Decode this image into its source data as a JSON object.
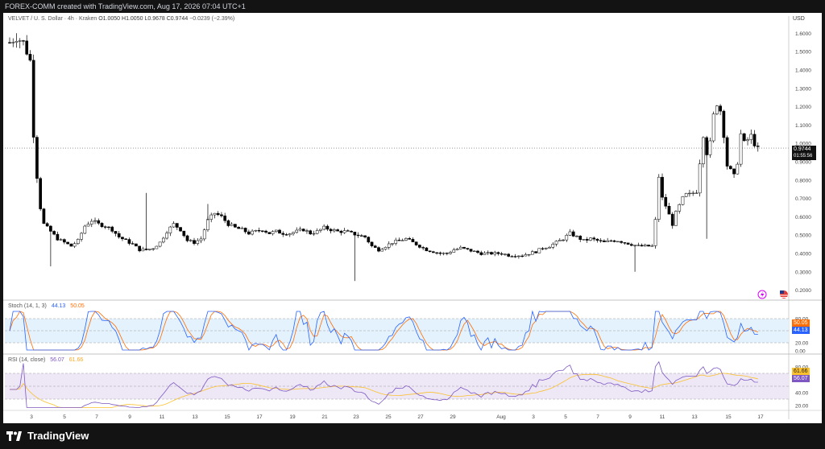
{
  "header": {
    "watermark": "FOREX-COMM created with TradingView.com, Aug 17, 2026 07:04 UTC+1"
  },
  "symbol": {
    "title": "VELVET / U. S. Dollar · 4h · Kraken",
    "ohlc": [
      {
        "label": "O",
        "value": "1.0050"
      },
      {
        "label": "H",
        "value": "1.0050"
      },
      {
        "label": "L",
        "value": "0.9678"
      },
      {
        "label": "C",
        "value": "0.9744"
      }
    ],
    "change": "−0.0239 (−2.39%)",
    "currency": "USD",
    "last_price": "0.9744",
    "countdown": "01:55:56"
  },
  "stoch": {
    "label": "Stoch (14, 1, 3)",
    "k": "44.13",
    "d": "50.05",
    "ticks": [
      "80.00",
      "20.00",
      "0.00"
    ],
    "k_color": "#2962ff",
    "d_color": "#ff6d00"
  },
  "rsi": {
    "label": "RSI (14, close)",
    "rsi": "56.07",
    "ma": "61.66",
    "ticks": [
      "80.00",
      "60.00",
      "40.00",
      "20.00"
    ],
    "rsi_color": "#7e57c2",
    "ma_color": "#fbc02d"
  },
  "xaxis": {
    "labels": [
      "3",
      "5",
      "7",
      "9",
      "11",
      "13",
      "15",
      "17",
      "19",
      "21",
      "23",
      "25",
      "27",
      "29",
      "Aug",
      "3",
      "5",
      "7",
      "9",
      "11",
      "13",
      "15",
      "17"
    ]
  },
  "brand": {
    "name": "TradingView"
  },
  "icons": [
    "lightning-icon",
    "us-flag-icon"
  ],
  "chart_data": {
    "type": "candlestick",
    "title": "VELVET / U. S. Dollar · 4h · Kraken",
    "ylabel": "USD",
    "y_ticks": [
      "1.6000",
      "1.5000",
      "1.4000",
      "1.3000",
      "1.2000",
      "1.1000",
      "1.0000",
      "0.9000",
      "0.8000",
      "0.7000",
      "0.6000",
      "0.5000",
      "0.4000",
      "0.3000",
      "0.2000"
    ],
    "ylim": [
      0.15,
      1.65
    ],
    "up_color": "#ffffff",
    "down_color": "#000000",
    "price_line": 0.9744,
    "x_labels": [
      "3",
      "5",
      "7",
      "9",
      "11",
      "13",
      "15",
      "17",
      "19",
      "21",
      "23",
      "25",
      "27",
      "29",
      "Aug",
      "3",
      "5",
      "7",
      "9",
      "11",
      "13",
      "15",
      "17"
    ],
    "close_path": [
      [
        0,
        1.55
      ],
      [
        2,
        1.58
      ],
      [
        4,
        1.55
      ],
      [
        6,
        1.45
      ],
      [
        7,
        1.05
      ],
      [
        8,
        0.82
      ],
      [
        9,
        0.65
      ],
      [
        10,
        0.56
      ],
      [
        12,
        0.52
      ],
      [
        14,
        0.48
      ],
      [
        16,
        0.46
      ],
      [
        18,
        0.44
      ],
      [
        20,
        0.47
      ],
      [
        22,
        0.55
      ],
      [
        24,
        0.58
      ],
      [
        26,
        0.56
      ],
      [
        28,
        0.55
      ],
      [
        30,
        0.53
      ],
      [
        32,
        0.49
      ],
      [
        34,
        0.47
      ],
      [
        36,
        0.45
      ],
      [
        38,
        0.42
      ],
      [
        40,
        0.42
      ],
      [
        42,
        0.43
      ],
      [
        44,
        0.46
      ],
      [
        46,
        0.52
      ],
      [
        48,
        0.56
      ],
      [
        50,
        0.53
      ],
      [
        52,
        0.47
      ],
      [
        54,
        0.46
      ],
      [
        56,
        0.48
      ],
      [
        58,
        0.58
      ],
      [
        60,
        0.62
      ],
      [
        62,
        0.6
      ],
      [
        64,
        0.56
      ],
      [
        66,
        0.54
      ],
      [
        68,
        0.53
      ],
      [
        70,
        0.51
      ],
      [
        72,
        0.52
      ],
      [
        74,
        0.53
      ],
      [
        76,
        0.51
      ],
      [
        78,
        0.52
      ],
      [
        80,
        0.51
      ],
      [
        82,
        0.51
      ],
      [
        84,
        0.52
      ],
      [
        86,
        0.53
      ],
      [
        88,
        0.51
      ],
      [
        90,
        0.52
      ],
      [
        92,
        0.54
      ],
      [
        94,
        0.53
      ],
      [
        96,
        0.52
      ],
      [
        98,
        0.52
      ],
      [
        100,
        0.51
      ],
      [
        102,
        0.5
      ],
      [
        104,
        0.49
      ],
      [
        106,
        0.44
      ],
      [
        108,
        0.42
      ],
      [
        110,
        0.44
      ],
      [
        112,
        0.46
      ],
      [
        114,
        0.47
      ],
      [
        116,
        0.48
      ],
      [
        118,
        0.46
      ],
      [
        120,
        0.44
      ],
      [
        122,
        0.42
      ],
      [
        124,
        0.41
      ],
      [
        126,
        0.4
      ],
      [
        128,
        0.4
      ],
      [
        130,
        0.42
      ],
      [
        132,
        0.43
      ],
      [
        134,
        0.42
      ],
      [
        136,
        0.41
      ],
      [
        138,
        0.4
      ],
      [
        140,
        0.4
      ],
      [
        142,
        0.4
      ],
      [
        144,
        0.4
      ],
      [
        146,
        0.39
      ],
      [
        148,
        0.39
      ],
      [
        150,
        0.39
      ],
      [
        152,
        0.4
      ],
      [
        154,
        0.41
      ],
      [
        156,
        0.43
      ],
      [
        158,
        0.44
      ],
      [
        160,
        0.46
      ],
      [
        162,
        0.48
      ],
      [
        164,
        0.51
      ],
      [
        166,
        0.49
      ],
      [
        168,
        0.47
      ],
      [
        170,
        0.48
      ],
      [
        172,
        0.47
      ],
      [
        174,
        0.46
      ],
      [
        176,
        0.47
      ],
      [
        178,
        0.47
      ],
      [
        180,
        0.46
      ],
      [
        182,
        0.45
      ],
      [
        184,
        0.44
      ],
      [
        186,
        0.44
      ],
      [
        188,
        0.44
      ],
      [
        189,
        0.58
      ],
      [
        190,
        0.82
      ],
      [
        191,
        0.7
      ],
      [
        192,
        0.66
      ],
      [
        193,
        0.61
      ],
      [
        194,
        0.56
      ],
      [
        195,
        0.62
      ],
      [
        196,
        0.66
      ],
      [
        197,
        0.7
      ],
      [
        198,
        0.72
      ],
      [
        199,
        0.72
      ],
      [
        200,
        0.73
      ],
      [
        201,
        0.74
      ],
      [
        202,
        0.9
      ],
      [
        203,
        1.05
      ],
      [
        204,
        0.95
      ],
      [
        205,
        1.0
      ],
      [
        206,
        1.15
      ],
      [
        207,
        1.22
      ],
      [
        208,
        1.18
      ],
      [
        209,
        1.05
      ],
      [
        210,
        0.88
      ],
      [
        211,
        0.85
      ],
      [
        212,
        0.82
      ],
      [
        213,
        0.9
      ],
      [
        214,
        1.05
      ],
      [
        215,
        1.0
      ],
      [
        216,
        1.02
      ],
      [
        217,
        1.04
      ],
      [
        218,
        1.0
      ],
      [
        219,
        0.97
      ]
    ]
  }
}
